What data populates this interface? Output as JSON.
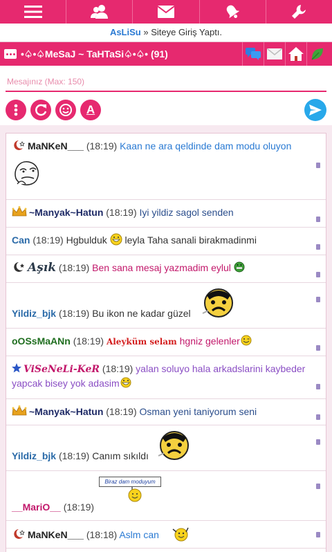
{
  "topnav": {
    "icons": [
      "menu-icon",
      "users-icon",
      "mail-icon",
      "bell-icon",
      "wrench-icon"
    ]
  },
  "notice": {
    "user": "AsLiSu",
    "sep": " » ",
    "text": "Siteye Giriş Yaptı."
  },
  "room": {
    "title": "•♤•♤MeSaJ ~ TaHTaSi♤•♤• (91)"
  },
  "composer": {
    "placeholder": "Mesajınız (Max: 150)"
  },
  "toolbar": {
    "font_letter": "A"
  },
  "messages": [
    {
      "nick": "MaNKeN___",
      "time": "(18:19)",
      "text": "Kaan ne ara qeldinde dam modu oluyon",
      "nick_color": "#222222",
      "text_color": "#2a7ad3"
    },
    {
      "nick": "~Manyak~Hatun",
      "time": "(18:19)",
      "text": "Iyi yildiz sagol senden",
      "nick_color": "#1e2a66",
      "text_color": "#2b4e8c"
    },
    {
      "nick": "Can",
      "time": "(18:19)",
      "text_before": "Hgbulduk",
      "text_after": "leyla Taha sanali birakmadinmi",
      "nick_color": "#2a6aa8",
      "text_color": "#333333"
    },
    {
      "nick": "Aşık",
      "time": "(18:19)",
      "text": "Ben sana mesaj yazmadim eylul",
      "nick_color": "#2b3a4a",
      "text_color": "#c2186b"
    },
    {
      "nick": "Yildiz_bjk",
      "time": "(18:19)",
      "text": "Bu ikon ne kadar güzel",
      "nick_color": "#2a6aa8",
      "text_color": "#333333"
    },
    {
      "nick": "oOSsMaANn",
      "time": "(18:19)",
      "sticker": "Aleyküm selam",
      "text": "hgniz gelenler",
      "nick_color": "#1f6e1f",
      "text_color": "#c2186b"
    },
    {
      "nick": "ViSeNeLi-KeR",
      "time": "(18:19)",
      "text": "yalan soluyo hala arkadslarini kaybeder yapcak bisey yok adasim",
      "nick_color": "#c2186b",
      "text_color": "#8a4ec4"
    },
    {
      "nick": "~Manyak~Hatun",
      "time": "(18:19)",
      "text": "Osman yeni taniyorum seni",
      "nick_color": "#1e2a66",
      "text_color": "#2b4e8c"
    },
    {
      "nick": "Yildiz_bjk",
      "time": "(18:19)",
      "text": "Canım sıkıldı",
      "nick_color": "#2a6aa8",
      "text_color": "#333333"
    },
    {
      "nick": "__MariO__",
      "time": "(18:19)",
      "sign": "Biraz dam moduyum",
      "nick_color": "#c2186b"
    },
    {
      "nick": "MaNKeN___",
      "time": "(18:18)",
      "text": "Aslm can",
      "nick_color": "#222222",
      "text_color": "#2a7ad3"
    }
  ],
  "colors": {
    "brand": "#e6296f",
    "send": "#28a8ea"
  }
}
